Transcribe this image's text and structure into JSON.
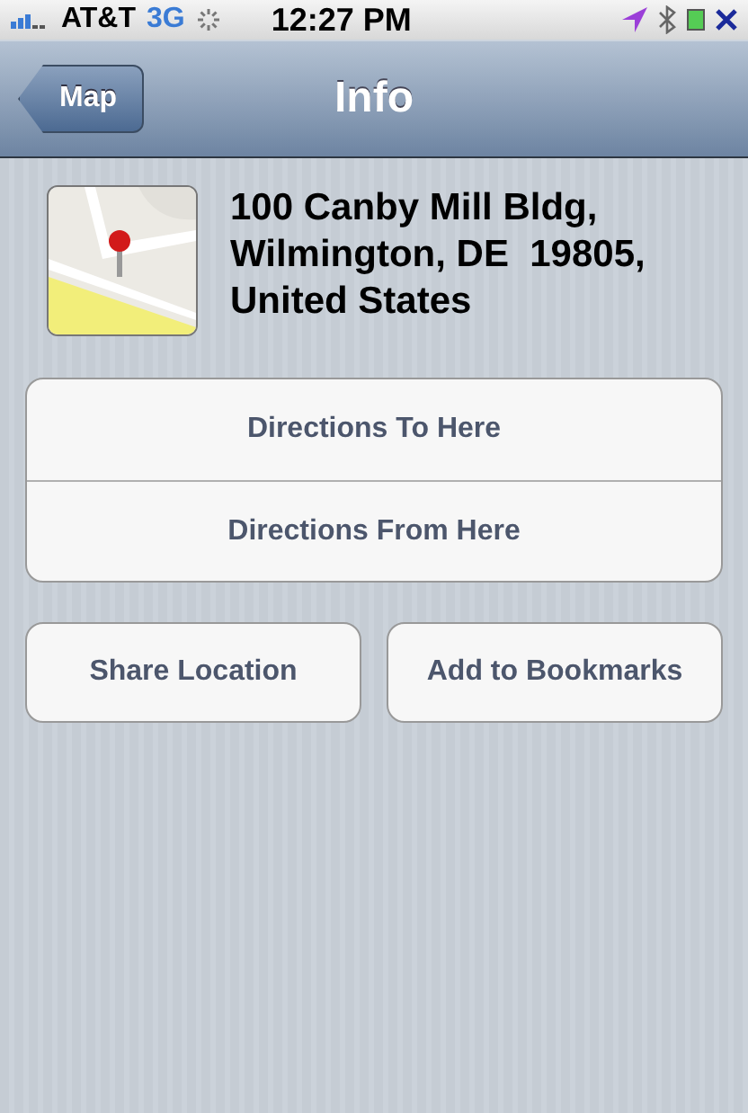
{
  "status_bar": {
    "carrier": "AT&T",
    "network": "3G",
    "time": "12:27 PM"
  },
  "nav_bar": {
    "back_button": "Map",
    "title": "Info"
  },
  "location": {
    "address_lines": [
      "100 Canby Mill Bldg,",
      "Wilmington, DE  19805,",
      "United States"
    ]
  },
  "direction_buttons": [
    "Directions To Here",
    "Directions From Here"
  ],
  "action_buttons": [
    "Share Location",
    "Add to Bookmarks"
  ]
}
